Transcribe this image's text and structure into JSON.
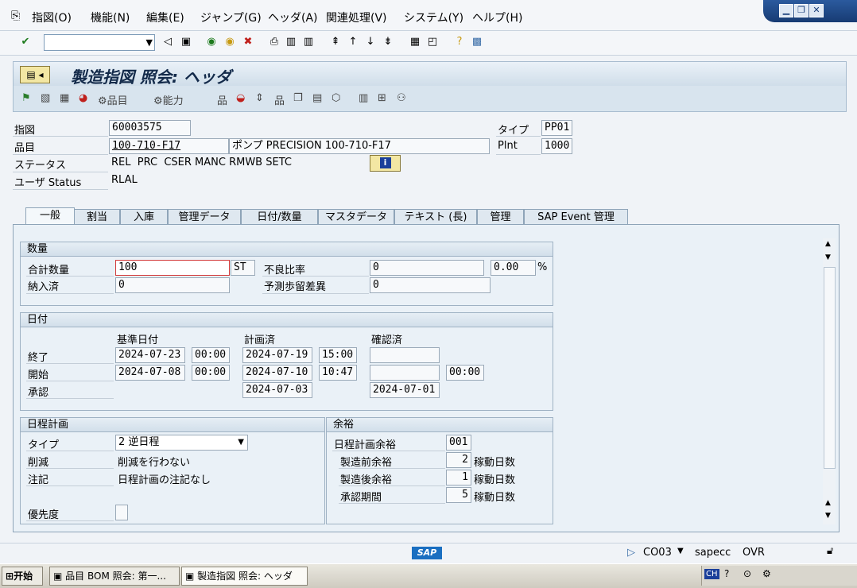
{
  "menu": {
    "items": [
      "指図(O)",
      "機能(N)",
      "編集(E)",
      "ジャンプ(G)",
      "ヘッダ(A)",
      "関連処理(V)",
      "システム(Y)",
      "ヘルプ(H)"
    ]
  },
  "window_controls": {
    "minimize": "▁",
    "restore": "❐",
    "close": "✕"
  },
  "title": "製造指図 照会: ヘッダ",
  "app_toolbar": {
    "parts_label": "品目",
    "capacity_label": "能力"
  },
  "header": {
    "order_label": "指図",
    "order_value": "60003575",
    "material_label": "品目",
    "material_value": "100-710-F17",
    "material_desc": "ポンプ PRECISION 100-710-F17",
    "status_label": "ステータス",
    "status_value": "REL  PRC  CSER MANC RMWB SETC",
    "user_status_label": "ユーザ Status",
    "user_status_value": "RLAL",
    "type_label": "タイプ",
    "type_value": "PP01",
    "plant_label": "Plnt",
    "plant_value": "1000"
  },
  "tabs": [
    "一般",
    "割当",
    "入庫",
    "管理データ",
    "日付/数量",
    "マスタデータ",
    "テキスト (長)",
    "管理",
    "SAP Event 管理"
  ],
  "quantity": {
    "title": "数量",
    "total_label": "合計数量",
    "total_value": "100",
    "unit": "ST",
    "scrap_label": "不良比率",
    "scrap_value": "0",
    "scrap_pct": "0.00",
    "pct_sign": "%",
    "delivered_label": "納入済",
    "delivered_value": "0",
    "expected_yield_label": "予測歩留差異",
    "expected_yield_value": "0"
  },
  "dates": {
    "title": "日付",
    "col_basic": "基準日付",
    "col_scheduled": "計画済",
    "col_confirmed": "確認済",
    "end_label": "終了",
    "end_basic_date": "2024-07-23",
    "end_basic_time": "00:00",
    "end_sched_date": "2024-07-19",
    "end_sched_time": "15:00",
    "end_conf_date": "",
    "start_label": "開始",
    "start_basic_date": "2024-07-08",
    "start_basic_time": "00:00",
    "start_sched_date": "2024-07-10",
    "start_sched_time": "10:47",
    "start_conf_date": "",
    "start_conf_time": "00:00",
    "release_label": "承認",
    "release_sched_date": "2024-07-03",
    "release_conf_date": "2024-07-01"
  },
  "scheduling": {
    "title": "日程計画",
    "type_label": "タイプ",
    "type_value": "2 逆日程",
    "reduction_label": "削減",
    "reduction_value": "削減を行わない",
    "note_label": "注記",
    "note_value": "日程計画の注記なし",
    "priority_label": "優先度"
  },
  "float": {
    "title": "余裕",
    "key_label": "日程計画余裕",
    "key_value": "001",
    "before_label": "製造前余裕",
    "before_value": "2",
    "before_unit": "稼動日数",
    "after_label": "製造後余裕",
    "after_value": "1",
    "after_unit": "稼動日数",
    "release_label": "承認期間",
    "release_value": "5",
    "release_unit": "稼動日数"
  },
  "statusbar": {
    "logo": "SAP",
    "tcode": "CO03",
    "server": "sapecc",
    "mode": "OVR"
  },
  "taskbar": {
    "start": "开始",
    "task1": "品目 BOM 照会: 第一...",
    "task2": "製造指図 照会: ヘッダ",
    "tray_lang": "CH"
  }
}
